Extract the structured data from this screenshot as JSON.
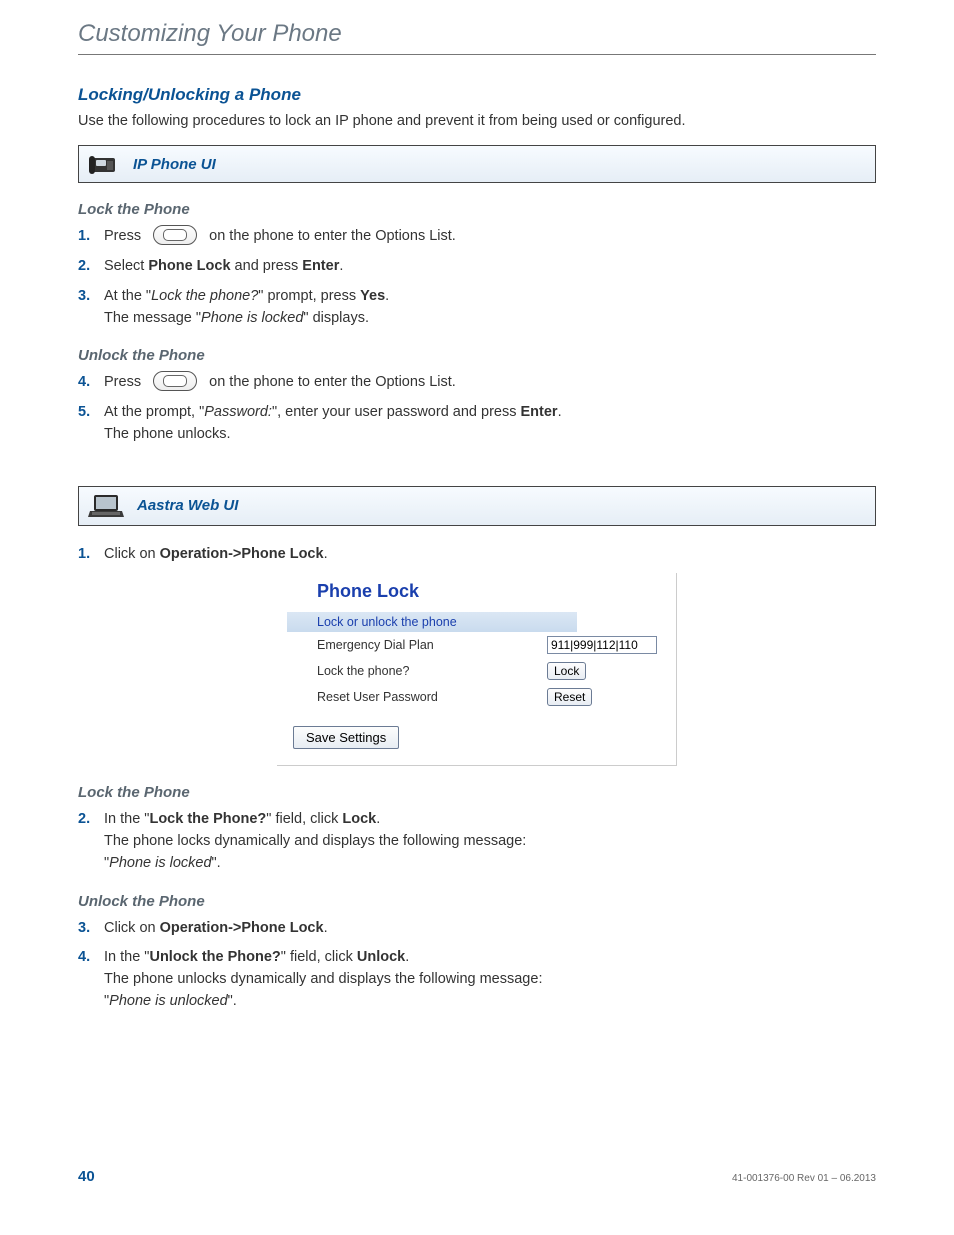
{
  "chapter_title": "Customizing Your Phone",
  "section": {
    "title": "Locking/Unlocking a Phone",
    "intro": "Use the following procedures to lock an IP phone and prevent it from being used or configured."
  },
  "ip_ui": {
    "banner": "IP Phone UI",
    "lock_heading": "Lock the Phone",
    "unlock_heading": "Unlock the Phone",
    "steps": {
      "s1_num": "1.",
      "s1_a": "Press",
      "s1_b": "on the phone to enter the Options List.",
      "s2_num": "2.",
      "s2_a": "Select ",
      "s2_bold1": "Phone Lock",
      "s2_b": " and press ",
      "s2_bold2": "Enter",
      "s2_c": ".",
      "s3_num": "3.",
      "s3_a": "At the \"",
      "s3_it": "Lock the phone?",
      "s3_b": "\" prompt, press ",
      "s3_bold": "Yes",
      "s3_c": ".",
      "s3_sub_a": "The message \"",
      "s3_sub_it": "Phone is locked",
      "s3_sub_b": "\" displays.",
      "s4_num": "4.",
      "s4_a": "Press",
      "s4_b": "on the phone to enter the Options List.",
      "s5_num": "5.",
      "s5_a": "At the prompt, \"",
      "s5_it": "Password:",
      "s5_b": "\", enter your user password and press ",
      "s5_bold": "Enter",
      "s5_c": ".",
      "s5_sub": "The phone unlocks."
    }
  },
  "web_ui": {
    "banner": "Aastra Web UI",
    "step1_num": "1.",
    "step1_a": "Click on ",
    "step1_bold": "Operation->Phone Lock",
    "step1_b": ".",
    "panel": {
      "title": "Phone Lock",
      "subtitle": "Lock or unlock the phone",
      "row1_label": "Emergency Dial Plan",
      "row1_value": "911|999|112|110",
      "row2_label": "Lock the phone?",
      "row2_button": "Lock",
      "row3_label": "Reset User Password",
      "row3_button": "Reset",
      "save": "Save Settings"
    },
    "lock_heading": "Lock the Phone",
    "step2_num": "2.",
    "step2_a": "In the \"",
    "step2_bold1": "Lock the Phone?",
    "step2_b": "\" field, click ",
    "step2_bold2": "Lock",
    "step2_c": ".",
    "step2_sub1": "The phone locks dynamically and displays the following message:",
    "step2_sub2_a": "\"",
    "step2_sub2_it": "Phone is locked",
    "step2_sub2_b": "\".",
    "unlock_heading": "Unlock the Phone",
    "step3_num": "3.",
    "step3_a": "Click on ",
    "step3_bold": "Operation->Phone Lock",
    "step3_b": ".",
    "step4_num": "4.",
    "step4_a": "In the \"",
    "step4_bold1": "Unlock the Phone?",
    "step4_b": "\" field, click ",
    "step4_bold2": "Unlock",
    "step4_c": ".",
    "step4_sub1": "The phone unlocks dynamically and displays the following message:",
    "step4_sub2_a": "\"",
    "step4_sub2_it": "Phone is unlocked",
    "step4_sub2_b": "\"."
  },
  "footer": {
    "page": "40",
    "rev": "41-001376-00 Rev 01 – 06.2013"
  }
}
